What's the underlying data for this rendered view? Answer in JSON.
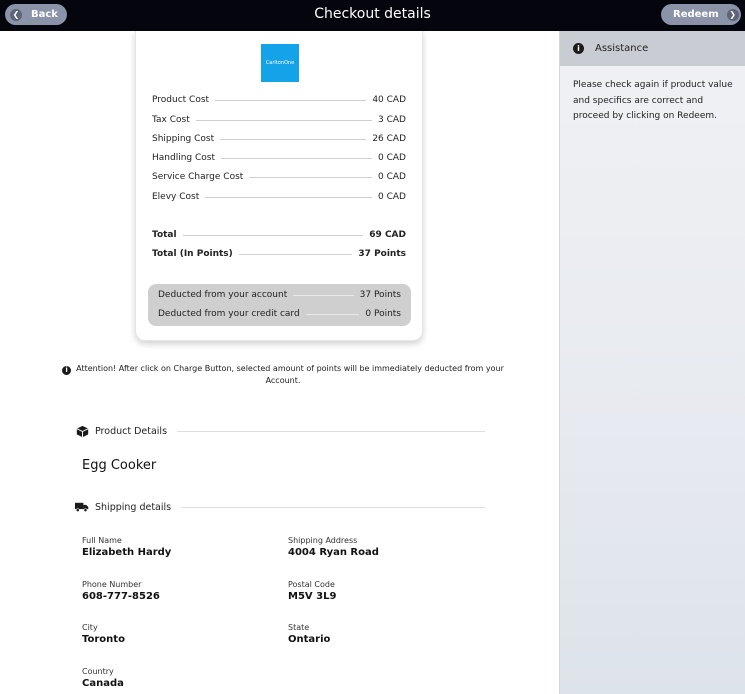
{
  "header": {
    "title": "Checkout details",
    "back_label": "Back",
    "redeem_label": "Redeem"
  },
  "receipt": {
    "logo_text": "CarltonOne",
    "rows": [
      {
        "label": "Product Cost",
        "value": "40 CAD"
      },
      {
        "label": "Tax Cost",
        "value": "3 CAD"
      },
      {
        "label": "Shipping Cost",
        "value": "26 CAD"
      },
      {
        "label": "Handling Cost",
        "value": "0 CAD"
      },
      {
        "label": "Service Charge Cost",
        "value": "0 CAD"
      },
      {
        "label": "Elevy Cost",
        "value": "0 CAD"
      }
    ],
    "totals": [
      {
        "label": "Total",
        "value": "69 CAD"
      },
      {
        "label": "Total (In Points)",
        "value": "37 Points"
      }
    ],
    "deductions": [
      {
        "label": "Deducted from your account",
        "value": "37 Points"
      },
      {
        "label": "Deducted from your credit card",
        "value": "0 Points"
      }
    ]
  },
  "attention": "Attention! After click on Charge Button, selected amount of points will be immediately deducted from your Account.",
  "product_section": {
    "title": "Product Details",
    "product_name": "Egg Cooker"
  },
  "shipping_section": {
    "title": "Shipping details",
    "fields": {
      "full_name": {
        "label": "Full Name",
        "value": "Elizabeth Hardy"
      },
      "shipping_address": {
        "label": "Shipping Address",
        "value": "4004 Ryan Road"
      },
      "phone": {
        "label": "Phone Number",
        "value": "608-777-8526"
      },
      "postal": {
        "label": "Postal Code",
        "value": "M5V 3L9"
      },
      "city": {
        "label": "City",
        "value": "Toronto"
      },
      "state": {
        "label": "State",
        "value": "Ontario"
      },
      "country": {
        "label": "Country",
        "value": "Canada"
      }
    }
  },
  "assistance": {
    "title": "Assistance",
    "text": "Please check again if product value and specifics are correct and proceed by clicking on Redeem."
  },
  "icons": {
    "back": "chevron-left-icon",
    "redeem": "chevron-right-icon",
    "info": "info-icon",
    "product": "box-icon",
    "shipping": "truck-icon"
  },
  "colors": {
    "topbar": "#05060d",
    "pill": "#8a93a8",
    "logo": "#14a3e8",
    "deduct_bg": "#cfcfcf"
  }
}
